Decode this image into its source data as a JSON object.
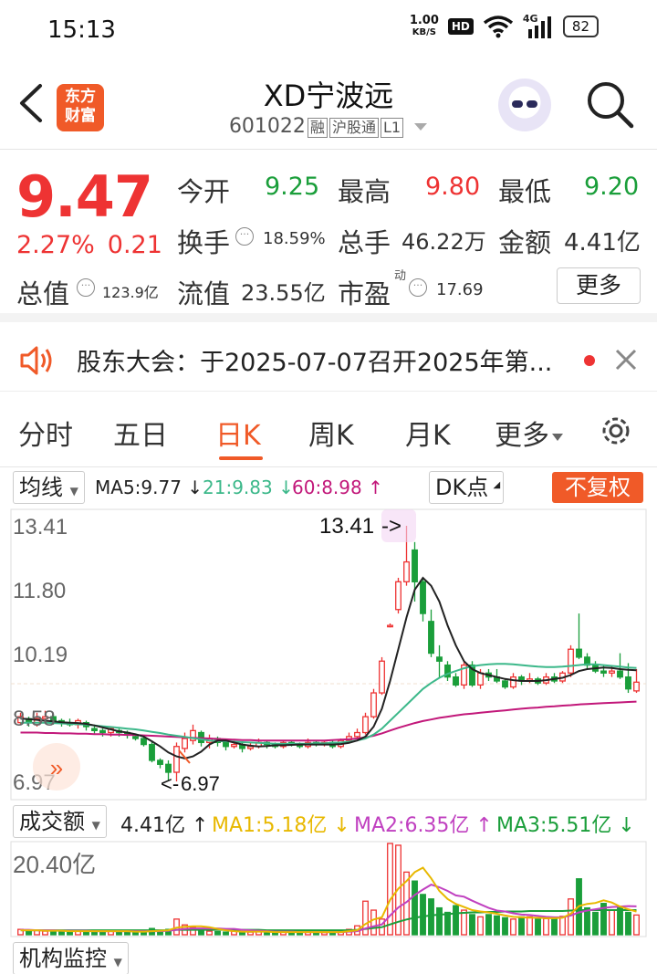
{
  "status": {
    "time": "15:13",
    "net_speed_value": "1.00",
    "net_speed_unit": "KB/S",
    "hd": "HD",
    "signal": "4G",
    "battery": "82"
  },
  "header": {
    "logo_line1": "东方",
    "logo_line2": "财富",
    "name": "XD宁波远",
    "code": "601022",
    "tag1": "融",
    "tag2": "沪股通",
    "tag3": "L1"
  },
  "quote": {
    "price": "9.47",
    "change_pct": "2.27%",
    "change_abs": "0.21",
    "open_label": "今开",
    "open": "9.25",
    "high_label": "最高",
    "high": "9.80",
    "low_label": "最低",
    "low": "9.20",
    "turnover_label": "换手",
    "turnover": "18.59%",
    "volume_label": "总手",
    "volume": "46.22万",
    "amount_label": "金额",
    "amount": "4.41亿",
    "mktcap_label": "总值",
    "mktcap": "123.9亿",
    "float_label": "流值",
    "float": "23.55亿",
    "pe_label": "市盈",
    "pe_sup": "动",
    "pe": "17.69",
    "more": "更多"
  },
  "notice": {
    "text": "股东大会：于2025-07-07召开2025年第..."
  },
  "tabs": [
    "分时",
    "五日",
    "日K",
    "周K",
    "月K",
    "更多"
  ],
  "kline_bar": {
    "indicator": "均线",
    "ma5": "MA5:9.77",
    "ma21": "21:9.83",
    "ma60": "60:8.98",
    "dk": "DK点",
    "adjust": "不复权"
  },
  "volume_bar": {
    "indicator": "成交额",
    "amount": "4.41亿",
    "ma1": "MA1:5.18亿",
    "ma2": "MA2:6.35亿",
    "ma3": "MA3:5.51亿",
    "bottom_dd": "机构监控"
  },
  "colors": {
    "up": "#e33",
    "down": "#1a9e3a",
    "accent": "#f05a28",
    "ma5": "#222222",
    "ma21": "#3cb88a",
    "ma60": "#c2187a",
    "vol_ma1": "#e8b800",
    "vol_ma2": "#c040c0",
    "vol_ma3": "#1a9e3a"
  },
  "chart_data": {
    "type": "candlestick",
    "y_ticks": [
      "13.41",
      "11.80",
      "10.19",
      "8.58",
      "6.97"
    ],
    "ylim": [
      6.97,
      13.41
    ],
    "max_label": "13.41",
    "min_label": "6.97",
    "candles": [
      {
        "o": 8.45,
        "c": 8.6,
        "h": 8.7,
        "l": 8.4
      },
      {
        "o": 8.55,
        "c": 8.45,
        "h": 8.6,
        "l": 8.35
      },
      {
        "o": 8.4,
        "c": 8.55,
        "h": 8.7,
        "l": 8.35
      },
      {
        "o": 8.55,
        "c": 8.6,
        "h": 8.75,
        "l": 8.45
      },
      {
        "o": 8.6,
        "c": 8.5,
        "h": 8.65,
        "l": 8.4
      },
      {
        "o": 8.5,
        "c": 8.45,
        "h": 8.55,
        "l": 8.35
      },
      {
        "o": 8.45,
        "c": 8.4,
        "h": 8.55,
        "l": 8.35
      },
      {
        "o": 8.4,
        "c": 8.5,
        "h": 8.55,
        "l": 8.3
      },
      {
        "o": 8.45,
        "c": 8.35,
        "h": 8.5,
        "l": 8.25
      },
      {
        "o": 8.3,
        "c": 8.25,
        "h": 8.4,
        "l": 8.15
      },
      {
        "o": 8.25,
        "c": 8.2,
        "h": 8.3,
        "l": 8.1
      },
      {
        "o": 8.2,
        "c": 8.3,
        "h": 8.35,
        "l": 8.1
      },
      {
        "o": 8.25,
        "c": 8.2,
        "h": 8.3,
        "l": 8.1
      },
      {
        "o": 8.2,
        "c": 8.15,
        "h": 8.25,
        "l": 8.05
      },
      {
        "o": 8.1,
        "c": 8.05,
        "h": 8.15,
        "l": 8.0
      },
      {
        "o": 8.05,
        "c": 7.9,
        "h": 8.1,
        "l": 7.85
      },
      {
        "o": 7.9,
        "c": 7.5,
        "h": 8.0,
        "l": 7.45
      },
      {
        "o": 7.5,
        "c": 7.4,
        "h": 7.55,
        "l": 7.3
      },
      {
        "o": 7.4,
        "c": 7.2,
        "h": 7.5,
        "l": 7.0
      },
      {
        "o": 7.2,
        "c": 7.85,
        "h": 7.95,
        "l": 6.97
      },
      {
        "o": 7.8,
        "c": 8.05,
        "h": 8.2,
        "l": 7.7
      },
      {
        "o": 8.0,
        "c": 8.25,
        "h": 8.4,
        "l": 7.9
      },
      {
        "o": 8.2,
        "c": 7.95,
        "h": 8.25,
        "l": 7.85
      },
      {
        "o": 7.95,
        "c": 8.05,
        "h": 8.15,
        "l": 7.8
      },
      {
        "o": 8.05,
        "c": 7.95,
        "h": 8.1,
        "l": 7.85
      },
      {
        "o": 7.95,
        "c": 7.85,
        "h": 8.0,
        "l": 7.75
      },
      {
        "o": 7.85,
        "c": 7.9,
        "h": 8.0,
        "l": 7.8
      },
      {
        "o": 7.9,
        "c": 7.8,
        "h": 7.95,
        "l": 7.7
      },
      {
        "o": 7.8,
        "c": 7.85,
        "h": 7.95,
        "l": 7.75
      },
      {
        "o": 7.85,
        "c": 7.95,
        "h": 8.05,
        "l": 7.8
      },
      {
        "o": 7.95,
        "c": 7.9,
        "h": 8.0,
        "l": 7.8
      },
      {
        "o": 7.9,
        "c": 7.85,
        "h": 7.95,
        "l": 7.8
      },
      {
        "o": 7.85,
        "c": 7.95,
        "h": 8.0,
        "l": 7.8
      },
      {
        "o": 7.95,
        "c": 7.9,
        "h": 8.0,
        "l": 7.85
      },
      {
        "o": 7.9,
        "c": 7.85,
        "h": 7.95,
        "l": 7.8
      },
      {
        "o": 7.85,
        "c": 7.95,
        "h": 8.05,
        "l": 7.8
      },
      {
        "o": 7.95,
        "c": 7.9,
        "h": 8.0,
        "l": 7.85
      },
      {
        "o": 7.9,
        "c": 7.95,
        "h": 8.0,
        "l": 7.85
      },
      {
        "o": 7.95,
        "c": 7.85,
        "h": 8.0,
        "l": 7.8
      },
      {
        "o": 7.85,
        "c": 8.0,
        "h": 8.05,
        "l": 7.8
      },
      {
        "o": 8.0,
        "c": 8.1,
        "h": 8.2,
        "l": 7.95
      },
      {
        "o": 8.1,
        "c": 8.2,
        "h": 8.3,
        "l": 8.05
      },
      {
        "o": 8.2,
        "c": 8.6,
        "h": 8.7,
        "l": 8.15
      },
      {
        "o": 8.6,
        "c": 9.2,
        "h": 9.3,
        "l": 8.55
      },
      {
        "o": 9.2,
        "c": 10.0,
        "h": 10.1,
        "l": 9.15
      },
      {
        "o": 10.9,
        "c": 10.9,
        "h": 10.95,
        "l": 10.85
      },
      {
        "o": 11.3,
        "c": 12.0,
        "h": 12.1,
        "l": 11.2
      },
      {
        "o": 12.0,
        "c": 12.5,
        "h": 13.41,
        "l": 11.9
      },
      {
        "o": 12.8,
        "c": 12.0,
        "h": 13.0,
        "l": 11.5
      },
      {
        "o": 12.0,
        "c": 11.2,
        "h": 12.1,
        "l": 11.0
      },
      {
        "o": 11.0,
        "c": 10.2,
        "h": 11.3,
        "l": 10.1
      },
      {
        "o": 10.1,
        "c": 10.0,
        "h": 10.4,
        "l": 9.6
      },
      {
        "o": 9.9,
        "c": 9.6,
        "h": 10.0,
        "l": 9.5
      },
      {
        "o": 9.6,
        "c": 9.4,
        "h": 9.7,
        "l": 9.35
      },
      {
        "o": 9.4,
        "c": 9.9,
        "h": 10.0,
        "l": 9.3
      },
      {
        "o": 9.9,
        "c": 9.4,
        "h": 10.0,
        "l": 9.35
      },
      {
        "o": 9.4,
        "c": 9.7,
        "h": 9.8,
        "l": 9.3
      },
      {
        "o": 9.7,
        "c": 9.6,
        "h": 9.8,
        "l": 9.5
      },
      {
        "o": 9.6,
        "c": 9.5,
        "h": 9.8,
        "l": 9.45
      },
      {
        "o": 9.5,
        "c": 9.35,
        "h": 9.55,
        "l": 9.3
      },
      {
        "o": 9.35,
        "c": 9.6,
        "h": 9.7,
        "l": 9.3
      },
      {
        "o": 9.6,
        "c": 9.5,
        "h": 9.65,
        "l": 9.4
      },
      {
        "o": 9.5,
        "c": 9.55,
        "h": 9.7,
        "l": 9.45
      },
      {
        "o": 9.55,
        "c": 9.45,
        "h": 9.6,
        "l": 9.4
      },
      {
        "o": 9.45,
        "c": 9.6,
        "h": 9.7,
        "l": 9.4
      },
      {
        "o": 9.6,
        "c": 9.5,
        "h": 9.7,
        "l": 9.45
      },
      {
        "o": 9.5,
        "c": 9.7,
        "h": 9.75,
        "l": 9.45
      },
      {
        "o": 9.7,
        "c": 10.3,
        "h": 10.4,
        "l": 9.6
      },
      {
        "o": 10.3,
        "c": 10.1,
        "h": 11.2,
        "l": 10.05
      },
      {
        "o": 10.1,
        "c": 9.9,
        "h": 10.2,
        "l": 9.8
      },
      {
        "o": 9.9,
        "c": 9.75,
        "h": 10.0,
        "l": 9.7
      },
      {
        "o": 9.75,
        "c": 9.7,
        "h": 9.9,
        "l": 9.6
      },
      {
        "o": 9.7,
        "c": 9.75,
        "h": 9.9,
        "l": 9.6
      },
      {
        "o": 9.75,
        "c": 9.6,
        "h": 10.2,
        "l": 9.55
      },
      {
        "o": 9.6,
        "c": 9.3,
        "h": 9.95,
        "l": 9.2
      },
      {
        "o": 9.25,
        "c": 9.47,
        "h": 9.8,
        "l": 9.2
      }
    ],
    "ma5": [
      8.55,
      8.54,
      8.52,
      8.5,
      8.48,
      8.46,
      8.45,
      8.44,
      8.42,
      8.38,
      8.33,
      8.28,
      8.23,
      8.2,
      8.16,
      8.1,
      7.98,
      7.85,
      7.7,
      7.6,
      7.55,
      7.6,
      7.72,
      7.9,
      8.0,
      8.0,
      7.95,
      7.9,
      7.87,
      7.85,
      7.86,
      7.88,
      7.88,
      7.89,
      7.9,
      7.9,
      7.9,
      7.9,
      7.9,
      7.91,
      7.94,
      8.0,
      8.1,
      8.35,
      8.8,
      9.5,
      10.3,
      11.1,
      11.8,
      12.1,
      11.9,
      11.5,
      10.9,
      10.4,
      10.0,
      9.8,
      9.7,
      9.65,
      9.6,
      9.55,
      9.52,
      9.5,
      9.5,
      9.5,
      9.52,
      9.55,
      9.58,
      9.65,
      9.75,
      9.8,
      9.82,
      9.84,
      9.83,
      9.8,
      9.78,
      9.77
    ],
    "ma21": [
      8.45,
      8.45,
      8.45,
      8.45,
      8.44,
      8.43,
      8.42,
      8.41,
      8.4,
      8.38,
      8.36,
      8.34,
      8.32,
      8.3,
      8.28,
      8.25,
      8.22,
      8.19,
      8.15,
      8.12,
      8.09,
      8.06,
      8.03,
      8.0,
      7.99,
      7.98,
      7.97,
      7.96,
      7.95,
      7.94,
      7.93,
      7.92,
      7.92,
      7.92,
      7.92,
      7.92,
      7.93,
      7.93,
      7.94,
      7.95,
      7.97,
      8.0,
      8.05,
      8.15,
      8.3,
      8.5,
      8.7,
      8.9,
      9.1,
      9.3,
      9.45,
      9.58,
      9.68,
      9.75,
      9.82,
      9.87,
      9.9,
      9.92,
      9.93,
      9.93,
      9.92,
      9.9,
      9.88,
      9.86,
      9.85,
      9.85,
      9.86,
      9.88,
      9.9,
      9.92,
      9.92,
      9.9,
      9.88,
      9.86,
      9.84,
      9.83
    ],
    "ma60": [
      8.2,
      8.2,
      8.2,
      8.19,
      8.19,
      8.18,
      8.18,
      8.17,
      8.17,
      8.16,
      8.16,
      8.15,
      8.15,
      8.14,
      8.14,
      8.13,
      8.12,
      8.11,
      8.1,
      8.09,
      8.08,
      8.07,
      8.06,
      8.05,
      8.04,
      8.03,
      8.02,
      8.01,
      8.01,
      8.0,
      8.0,
      8.0,
      8.0,
      8.0,
      8.0,
      8.0,
      8.0,
      8.0,
      8.01,
      8.02,
      8.03,
      8.05,
      8.08,
      8.12,
      8.18,
      8.25,
      8.32,
      8.38,
      8.44,
      8.49,
      8.53,
      8.57,
      8.6,
      8.63,
      8.66,
      8.68,
      8.7,
      8.72,
      8.74,
      8.76,
      8.78,
      8.8,
      8.82,
      8.83,
      8.85,
      8.86,
      8.88,
      8.89,
      8.91,
      8.92,
      8.93,
      8.94,
      8.95,
      8.96,
      8.97,
      8.98
    ],
    "volume_ylabel": "20.40亿",
    "volume_max": 20.4,
    "volumes": [
      1.2,
      0.9,
      1.0,
      0.8,
      0.9,
      0.8,
      0.7,
      0.8,
      0.9,
      0.8,
      0.7,
      0.9,
      0.8,
      0.6,
      0.7,
      0.8,
      1.4,
      0.9,
      1.2,
      3.5,
      2.2,
      1.6,
      1.1,
      0.8,
      0.7,
      0.6,
      0.8,
      0.7,
      0.6,
      0.7,
      0.6,
      0.5,
      0.6,
      0.5,
      0.6,
      0.7,
      0.6,
      0.5,
      0.6,
      0.8,
      1.2,
      2.0,
      7.5,
      5.5,
      3.5,
      20.4,
      20.0,
      14.0,
      12.0,
      9.0,
      8.0,
      6.0,
      5.0,
      6.5,
      5.5,
      4.5,
      4.0,
      4.5,
      4.2,
      3.8,
      3.5,
      4.0,
      4.0,
      3.5,
      3.6,
      3.8,
      4.1,
      8.0,
      12.5,
      6.0,
      5.0,
      7.0,
      5.5,
      6.0,
      5.0,
      4.41
    ],
    "vol_ma1": [
      1.0,
      1.0,
      1.0,
      0.9,
      0.9,
      0.9,
      0.8,
      0.8,
      0.8,
      0.8,
      0.8,
      0.8,
      0.8,
      0.8,
      0.7,
      0.7,
      0.8,
      0.9,
      1.0,
      1.6,
      1.8,
      1.9,
      1.9,
      1.7,
      1.3,
      1.0,
      0.8,
      0.7,
      0.7,
      0.7,
      0.7,
      0.6,
      0.6,
      0.6,
      0.6,
      0.6,
      0.6,
      0.6,
      0.6,
      0.6,
      0.8,
      1.0,
      2.4,
      3.4,
      3.9,
      7.8,
      10.3,
      12.0,
      14.0,
      15.0,
      12.6,
      9.8,
      8.0,
      6.9,
      6.2,
      5.5,
      5.2,
      5.0,
      4.7,
      4.3,
      4.0,
      3.9,
      3.8,
      3.8,
      3.7,
      3.7,
      3.8,
      4.7,
      6.4,
      6.9,
      7.1,
      7.7,
      7.2,
      6.3,
      5.7,
      5.18
    ],
    "vol_ma2": [
      1.1,
      1.1,
      1.0,
      1.0,
      1.0,
      0.9,
      0.9,
      0.9,
      0.9,
      0.8,
      0.8,
      0.8,
      0.8,
      0.8,
      0.8,
      0.8,
      0.8,
      0.8,
      0.9,
      1.1,
      1.3,
      1.4,
      1.4,
      1.4,
      1.4,
      1.3,
      1.3,
      1.1,
      1.0,
      0.9,
      0.8,
      0.7,
      0.7,
      0.7,
      0.6,
      0.6,
      0.6,
      0.6,
      0.6,
      0.6,
      0.7,
      0.8,
      1.4,
      1.9,
      2.3,
      4.3,
      6.1,
      7.3,
      8.9,
      10.1,
      11.2,
      10.6,
      9.8,
      8.8,
      8.5,
      7.6,
      6.8,
      6.0,
      5.4,
      5.2,
      4.8,
      4.5,
      4.4,
      4.2,
      4.0,
      3.9,
      3.9,
      4.3,
      5.0,
      5.4,
      5.7,
      6.0,
      6.2,
      6.3,
      6.4,
      6.35
    ],
    "vol_ma3": [
      1.0,
      1.0,
      1.0,
      1.0,
      1.0,
      1.0,
      1.0,
      1.0,
      1.0,
      1.0,
      1.0,
      1.0,
      1.0,
      1.0,
      1.0,
      1.0,
      1.0,
      1.0,
      1.0,
      1.1,
      1.1,
      1.1,
      1.1,
      1.1,
      1.1,
      1.1,
      1.1,
      1.1,
      1.1,
      1.1,
      1.0,
      1.0,
      1.0,
      1.0,
      1.0,
      1.0,
      1.0,
      1.0,
      1.0,
      1.0,
      1.0,
      1.1,
      1.3,
      1.5,
      1.7,
      2.3,
      2.9,
      3.4,
      3.8,
      4.1,
      4.3,
      4.5,
      4.6,
      4.8,
      4.9,
      5.0,
      5.0,
      5.1,
      5.1,
      5.2,
      5.2,
      5.2,
      5.3,
      5.3,
      5.3,
      5.3,
      5.3,
      5.4,
      5.5,
      5.5,
      5.5,
      5.5,
      5.5,
      5.5,
      5.5,
      5.51
    ]
  }
}
